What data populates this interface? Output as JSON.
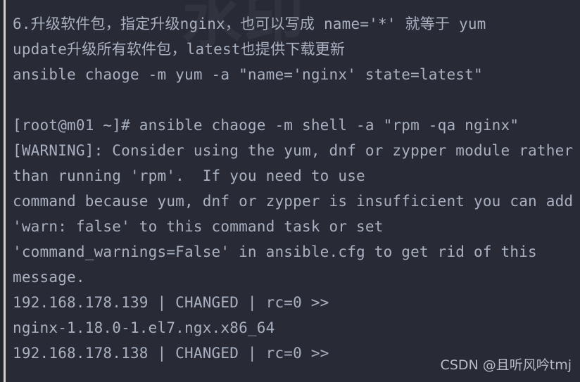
{
  "terminal": {
    "background_color": "#282a36",
    "text_color": "#a9b0c0",
    "gutter_rule_color": "#d6d2c4",
    "lines": [
      {
        "id": "line-1",
        "text": "6.升级软件包，指定升级nginx，也可以写成 name='*' 就等于 yum"
      },
      {
        "id": "line-2",
        "text": "update升级所有软件包，latest也提供下载更新"
      },
      {
        "id": "line-3",
        "text": "ansible chaoge -m yum -a \"name='nginx' state=latest\""
      },
      {
        "id": "line-4",
        "text": ""
      },
      {
        "id": "line-5",
        "text": "[root@m01 ~]# ansible chaoge -m shell -a \"rpm -qa nginx\""
      },
      {
        "id": "line-6",
        "text": "[WARNING]: Consider using the yum, dnf or zypper module rather"
      },
      {
        "id": "line-7",
        "text": "than running 'rpm'.  If you need to use"
      },
      {
        "id": "line-8",
        "text": "command because yum, dnf or zypper is insufficient you can add"
      },
      {
        "id": "line-9",
        "text": "'warn: false' to this command task or set"
      },
      {
        "id": "line-10",
        "text": "'command_warnings=False' in ansible.cfg to get rid of this"
      },
      {
        "id": "line-11",
        "text": "message."
      },
      {
        "id": "line-12",
        "text": "192.168.178.139 | CHANGED | rc=0 >>"
      },
      {
        "id": "line-13",
        "text": "nginx-1.18.0-1.el7.ngx.x86_64"
      },
      {
        "id": "line-14",
        "text": "192.168.178.138 | CHANGED | rc=0 >>"
      }
    ]
  },
  "watermarks": {
    "background_glyph": "水印",
    "csdn": "CSDN @且听风吟tmj"
  }
}
